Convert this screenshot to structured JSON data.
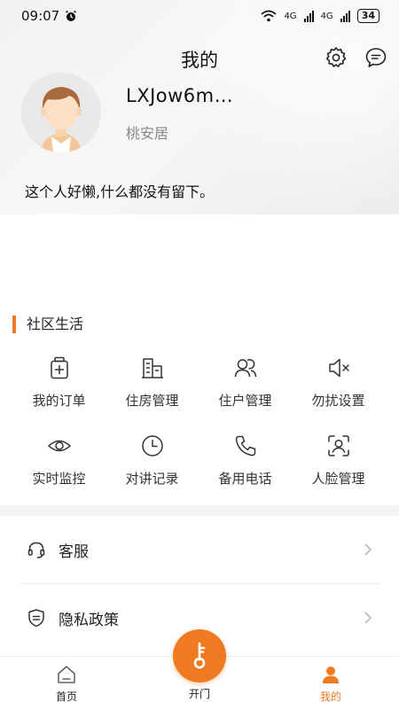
{
  "status_bar": {
    "time": "09:07",
    "network_1": "4G",
    "network_2": "4G",
    "battery": "34"
  },
  "header": {
    "title": "我的"
  },
  "profile": {
    "username": "LXJow6m…",
    "community": "桃安居",
    "bio": "这个人好懒,什么都没有留下。"
  },
  "community_life": {
    "title": "社区生活",
    "items": [
      {
        "label": "我的订单",
        "icon": "order-icon"
      },
      {
        "label": "住房管理",
        "icon": "building-icon"
      },
      {
        "label": "住户管理",
        "icon": "residents-icon"
      },
      {
        "label": "勿扰设置",
        "icon": "mute-icon"
      },
      {
        "label": "实时监控",
        "icon": "eye-icon"
      },
      {
        "label": "对讲记录",
        "icon": "clock-icon"
      },
      {
        "label": "备用电话",
        "icon": "phone-icon"
      },
      {
        "label": "人脸管理",
        "icon": "face-scan-icon"
      }
    ]
  },
  "menu": [
    {
      "label": "客服",
      "icon": "headset-icon"
    },
    {
      "label": "隐私政策",
      "icon": "shield-icon"
    }
  ],
  "bottom_nav": {
    "home": "首页",
    "open": "开门",
    "mine": "我的"
  },
  "colors": {
    "accent": "#f07a22"
  }
}
